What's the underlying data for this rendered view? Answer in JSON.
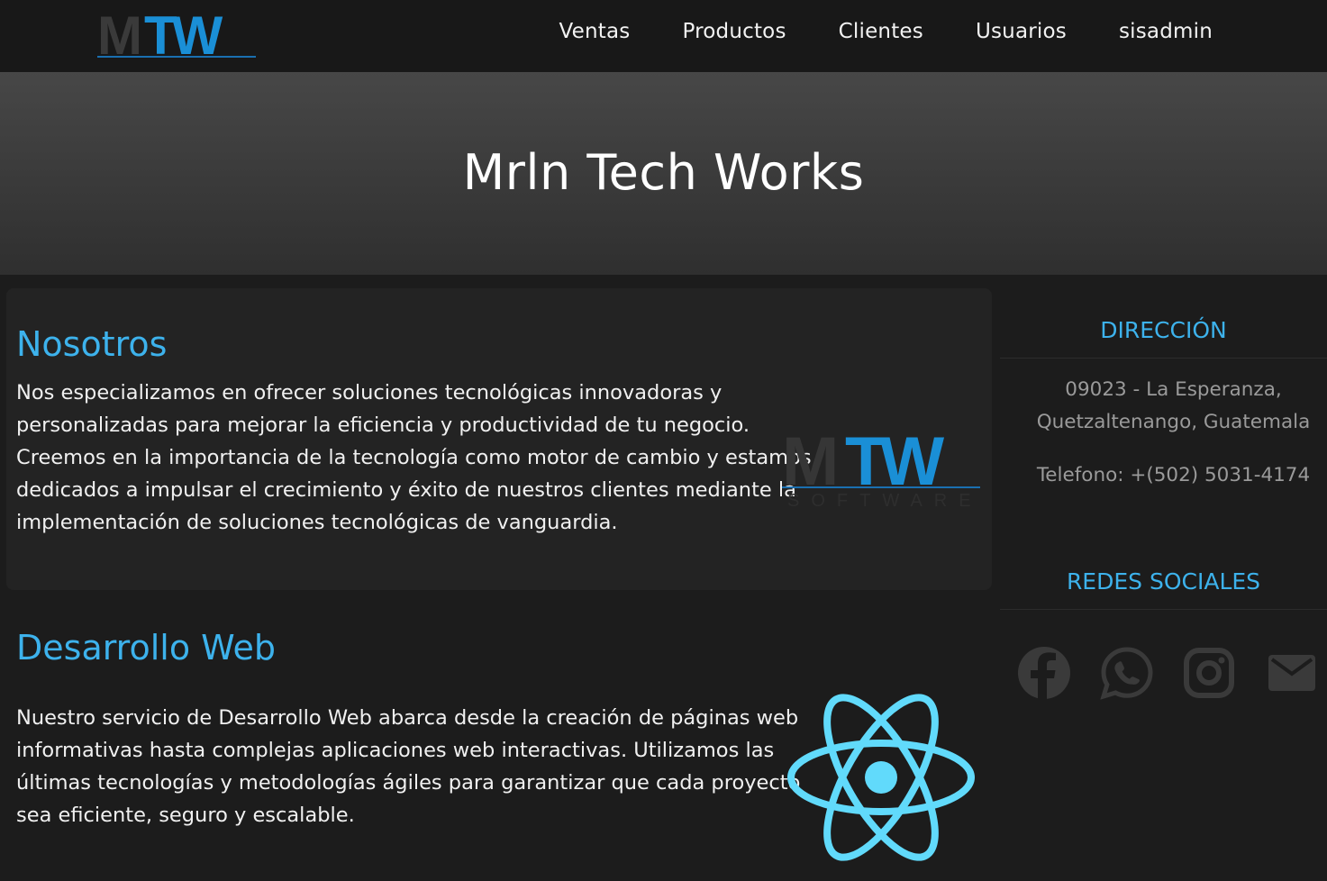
{
  "navbar": {
    "logo_text": "MTW",
    "links": [
      "Ventas",
      "Productos",
      "Clientes",
      "Usuarios",
      "sisadmin"
    ]
  },
  "hero": {
    "title": "Mrln Tech Works"
  },
  "nosotros": {
    "title": "Nosotros",
    "text_lines": [
      "Nos especializamos en ofrecer soluciones tecnológicas innovadoras y",
      "personalizadas para mejorar la eficiencia y productividad de tu negocio.",
      "Creemos en la importancia de la tecnología como motor de cambio y estamos",
      "dedicados a impulsar el crecimiento y éxito de nuestros clientes mediante la",
      "implementación de soluciones tecnológicas de vanguardia."
    ],
    "logo_text": "MTW",
    "logo_subtext": "SOFTWARE"
  },
  "desarrollo": {
    "title": "Desarrollo Web",
    "text_lines": [
      "Nuestro servicio de Desarrollo Web abarca desde la creación de páginas web",
      "informativas hasta complejas aplicaciones web interactivas. Utilizamos las",
      "últimas tecnologías y metodologías ágiles para garantizar que cada proyecto",
      "sea eficiente, seguro y escalable."
    ]
  },
  "sidebar": {
    "direccion_title": "DIRECCIÓN",
    "address_line1": "09023 - La Esperanza,",
    "address_line2": "Quetzaltenango, Guatemala",
    "phone": "Telefono: +(502) 5031-4174",
    "redes_title": "REDES SOCIALES",
    "social_icons": [
      "facebook-icon",
      "whatsapp-icon",
      "instagram-icon",
      "mail-icon"
    ]
  },
  "colors": {
    "accent": "#3db2ec",
    "background": "#1c1c1c",
    "card": "#232323",
    "navbar": "#181818",
    "react": "#61dafb",
    "icon_gray": "#3a3a3a"
  }
}
